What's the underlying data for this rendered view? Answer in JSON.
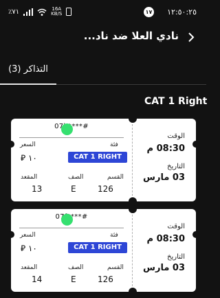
{
  "status_bar": {
    "time": "١٢:٥٠:٢٥",
    "notification_count": "١٧",
    "battery": "٪٧١",
    "net_speed_value": "16A",
    "net_speed_unit": "KB/S"
  },
  "header": {
    "title": "نادي العلا ضد ناد..."
  },
  "tabs": [
    {
      "label": "التذاكر (3)"
    }
  ],
  "section": {
    "title": "CAT 1 Right"
  },
  "ticket_labels": {
    "price": "السعر",
    "category": "فئة",
    "seat": "المقعد",
    "row": "الصف",
    "section": "القسم",
    "time": "الوقت",
    "date": "التاريخ"
  },
  "tickets": [
    {
      "barcode": "07b****#",
      "price": "١٠ ⃁",
      "category": "CAT 1 RIGHT",
      "seat": "13",
      "row": "E",
      "section": "126",
      "time": "08:30 م",
      "date": "03 مارس"
    },
    {
      "barcode": "07f****#",
      "price": "١٠ ⃁",
      "category": "CAT 1 RIGHT",
      "seat": "14",
      "row": "E",
      "section": "126",
      "time": "08:30 م",
      "date": "03 مارس"
    }
  ],
  "colors": {
    "background": "#121212",
    "accent": "#2d46d6",
    "indicator": "#35e06f"
  }
}
